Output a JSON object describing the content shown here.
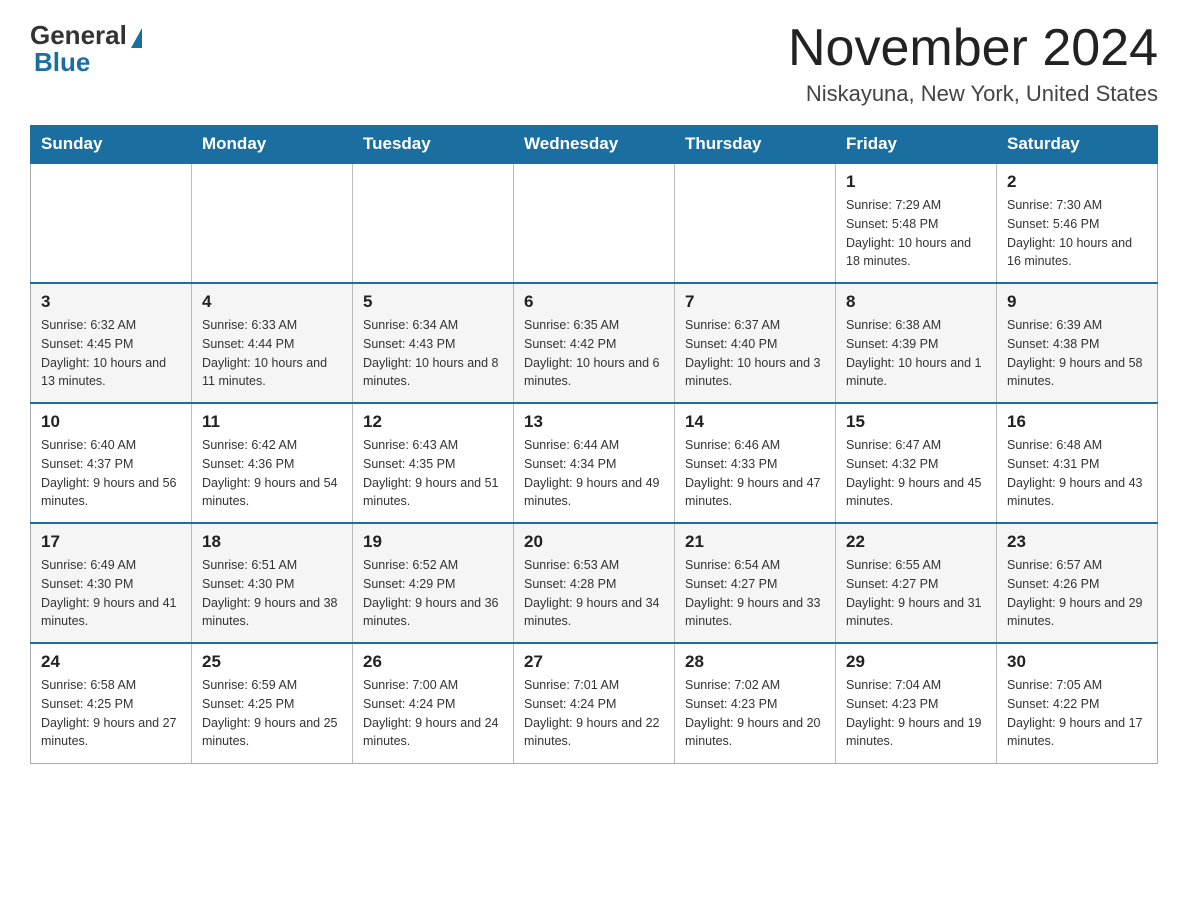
{
  "header": {
    "logo_line1": "General",
    "logo_line2": "Blue",
    "title": "November 2024",
    "subtitle": "Niskayuna, New York, United States"
  },
  "weekdays": [
    "Sunday",
    "Monday",
    "Tuesday",
    "Wednesday",
    "Thursday",
    "Friday",
    "Saturday"
  ],
  "weeks": [
    [
      {
        "day": "",
        "sunrise": "",
        "sunset": "",
        "daylight": ""
      },
      {
        "day": "",
        "sunrise": "",
        "sunset": "",
        "daylight": ""
      },
      {
        "day": "",
        "sunrise": "",
        "sunset": "",
        "daylight": ""
      },
      {
        "day": "",
        "sunrise": "",
        "sunset": "",
        "daylight": ""
      },
      {
        "day": "",
        "sunrise": "",
        "sunset": "",
        "daylight": ""
      },
      {
        "day": "1",
        "sunrise": "Sunrise: 7:29 AM",
        "sunset": "Sunset: 5:48 PM",
        "daylight": "Daylight: 10 hours and 18 minutes."
      },
      {
        "day": "2",
        "sunrise": "Sunrise: 7:30 AM",
        "sunset": "Sunset: 5:46 PM",
        "daylight": "Daylight: 10 hours and 16 minutes."
      }
    ],
    [
      {
        "day": "3",
        "sunrise": "Sunrise: 6:32 AM",
        "sunset": "Sunset: 4:45 PM",
        "daylight": "Daylight: 10 hours and 13 minutes."
      },
      {
        "day": "4",
        "sunrise": "Sunrise: 6:33 AM",
        "sunset": "Sunset: 4:44 PM",
        "daylight": "Daylight: 10 hours and 11 minutes."
      },
      {
        "day": "5",
        "sunrise": "Sunrise: 6:34 AM",
        "sunset": "Sunset: 4:43 PM",
        "daylight": "Daylight: 10 hours and 8 minutes."
      },
      {
        "day": "6",
        "sunrise": "Sunrise: 6:35 AM",
        "sunset": "Sunset: 4:42 PM",
        "daylight": "Daylight: 10 hours and 6 minutes."
      },
      {
        "day": "7",
        "sunrise": "Sunrise: 6:37 AM",
        "sunset": "Sunset: 4:40 PM",
        "daylight": "Daylight: 10 hours and 3 minutes."
      },
      {
        "day": "8",
        "sunrise": "Sunrise: 6:38 AM",
        "sunset": "Sunset: 4:39 PM",
        "daylight": "Daylight: 10 hours and 1 minute."
      },
      {
        "day": "9",
        "sunrise": "Sunrise: 6:39 AM",
        "sunset": "Sunset: 4:38 PM",
        "daylight": "Daylight: 9 hours and 58 minutes."
      }
    ],
    [
      {
        "day": "10",
        "sunrise": "Sunrise: 6:40 AM",
        "sunset": "Sunset: 4:37 PM",
        "daylight": "Daylight: 9 hours and 56 minutes."
      },
      {
        "day": "11",
        "sunrise": "Sunrise: 6:42 AM",
        "sunset": "Sunset: 4:36 PM",
        "daylight": "Daylight: 9 hours and 54 minutes."
      },
      {
        "day": "12",
        "sunrise": "Sunrise: 6:43 AM",
        "sunset": "Sunset: 4:35 PM",
        "daylight": "Daylight: 9 hours and 51 minutes."
      },
      {
        "day": "13",
        "sunrise": "Sunrise: 6:44 AM",
        "sunset": "Sunset: 4:34 PM",
        "daylight": "Daylight: 9 hours and 49 minutes."
      },
      {
        "day": "14",
        "sunrise": "Sunrise: 6:46 AM",
        "sunset": "Sunset: 4:33 PM",
        "daylight": "Daylight: 9 hours and 47 minutes."
      },
      {
        "day": "15",
        "sunrise": "Sunrise: 6:47 AM",
        "sunset": "Sunset: 4:32 PM",
        "daylight": "Daylight: 9 hours and 45 minutes."
      },
      {
        "day": "16",
        "sunrise": "Sunrise: 6:48 AM",
        "sunset": "Sunset: 4:31 PM",
        "daylight": "Daylight: 9 hours and 43 minutes."
      }
    ],
    [
      {
        "day": "17",
        "sunrise": "Sunrise: 6:49 AM",
        "sunset": "Sunset: 4:30 PM",
        "daylight": "Daylight: 9 hours and 41 minutes."
      },
      {
        "day": "18",
        "sunrise": "Sunrise: 6:51 AM",
        "sunset": "Sunset: 4:30 PM",
        "daylight": "Daylight: 9 hours and 38 minutes."
      },
      {
        "day": "19",
        "sunrise": "Sunrise: 6:52 AM",
        "sunset": "Sunset: 4:29 PM",
        "daylight": "Daylight: 9 hours and 36 minutes."
      },
      {
        "day": "20",
        "sunrise": "Sunrise: 6:53 AM",
        "sunset": "Sunset: 4:28 PM",
        "daylight": "Daylight: 9 hours and 34 minutes."
      },
      {
        "day": "21",
        "sunrise": "Sunrise: 6:54 AM",
        "sunset": "Sunset: 4:27 PM",
        "daylight": "Daylight: 9 hours and 33 minutes."
      },
      {
        "day": "22",
        "sunrise": "Sunrise: 6:55 AM",
        "sunset": "Sunset: 4:27 PM",
        "daylight": "Daylight: 9 hours and 31 minutes."
      },
      {
        "day": "23",
        "sunrise": "Sunrise: 6:57 AM",
        "sunset": "Sunset: 4:26 PM",
        "daylight": "Daylight: 9 hours and 29 minutes."
      }
    ],
    [
      {
        "day": "24",
        "sunrise": "Sunrise: 6:58 AM",
        "sunset": "Sunset: 4:25 PM",
        "daylight": "Daylight: 9 hours and 27 minutes."
      },
      {
        "day": "25",
        "sunrise": "Sunrise: 6:59 AM",
        "sunset": "Sunset: 4:25 PM",
        "daylight": "Daylight: 9 hours and 25 minutes."
      },
      {
        "day": "26",
        "sunrise": "Sunrise: 7:00 AM",
        "sunset": "Sunset: 4:24 PM",
        "daylight": "Daylight: 9 hours and 24 minutes."
      },
      {
        "day": "27",
        "sunrise": "Sunrise: 7:01 AM",
        "sunset": "Sunset: 4:24 PM",
        "daylight": "Daylight: 9 hours and 22 minutes."
      },
      {
        "day": "28",
        "sunrise": "Sunrise: 7:02 AM",
        "sunset": "Sunset: 4:23 PM",
        "daylight": "Daylight: 9 hours and 20 minutes."
      },
      {
        "day": "29",
        "sunrise": "Sunrise: 7:04 AM",
        "sunset": "Sunset: 4:23 PM",
        "daylight": "Daylight: 9 hours and 19 minutes."
      },
      {
        "day": "30",
        "sunrise": "Sunrise: 7:05 AM",
        "sunset": "Sunset: 4:22 PM",
        "daylight": "Daylight: 9 hours and 17 minutes."
      }
    ]
  ]
}
